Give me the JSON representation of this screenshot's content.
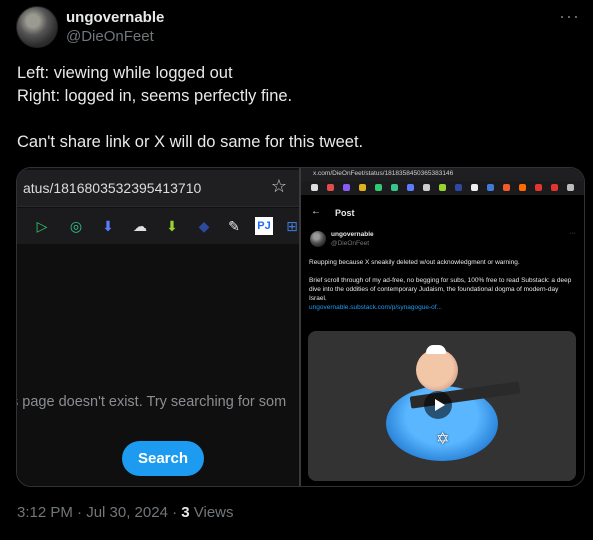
{
  "tweet": {
    "display_name": "ungovernable",
    "handle": "@DieOnFeet",
    "more_label": "···",
    "text_lines": [
      "Left: viewing while logged out",
      "Right: logged in, seems perfectly fine.",
      "",
      "Can't share link or X will do same for this tweet."
    ],
    "timestamp": "3:12 PM · Jul 30, 2024 · ",
    "views_count": "3",
    "views_label": " Views"
  },
  "left_shot": {
    "url": "atus/1816803532395413710",
    "not_found_text": "s page doesn't exist. Try searching for som",
    "search_button": "Search",
    "star": "☆"
  },
  "right_shot": {
    "url": "x.com/DieOnFeet/status/1818358450365383146",
    "back": "←",
    "post_label": "Post",
    "name": "ungovernable",
    "handle": "@DieOnFeet",
    "more": "···",
    "body_1": "Reupping because X sneakily deleted w/out acknowledgment or warning.",
    "body_2": "Brief scroll through of my ad-free, no begging for subs, 100% free to read Substack: a deep dive into the oddities of contemporary Judaism, the foundational dogma of modern-day Israel.",
    "link": "ungovernable.substack.com/p/synagogue-of..."
  }
}
